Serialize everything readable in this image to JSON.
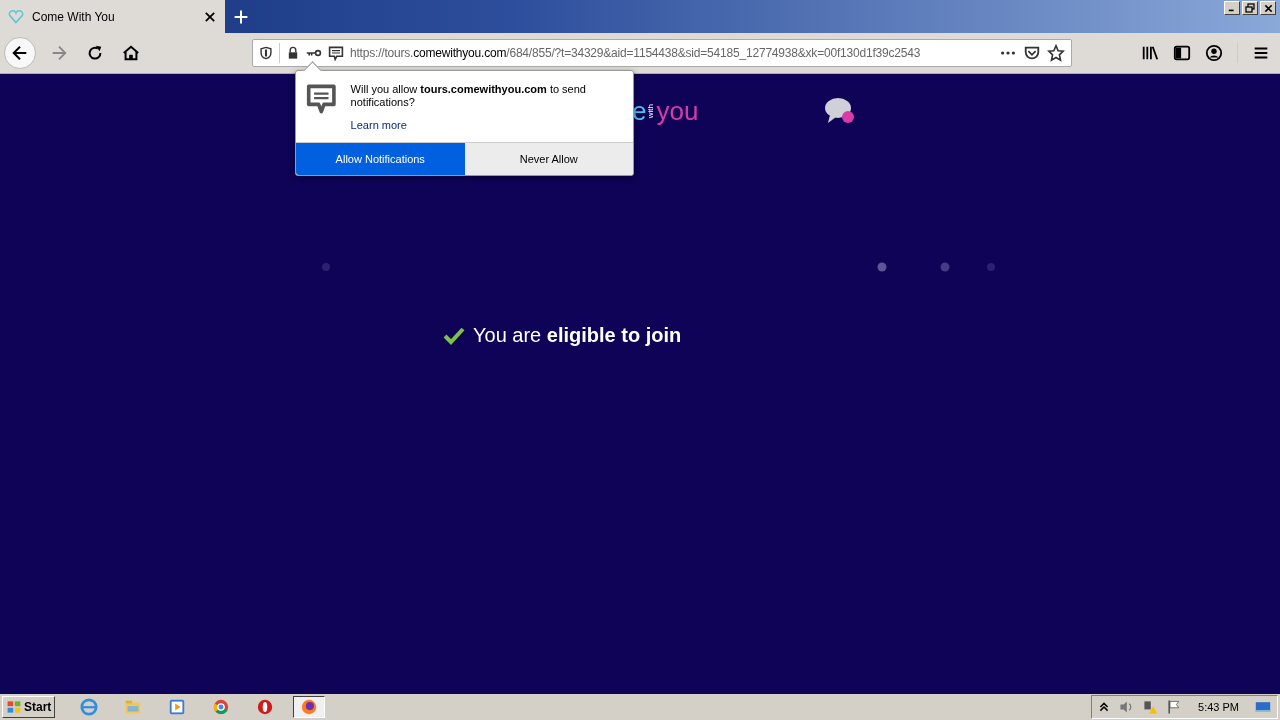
{
  "browser": {
    "tab": {
      "title": "Come With You",
      "selected": true
    },
    "url": {
      "prefix": "https://tours.",
      "domain": "comewithyou.com",
      "rest": "/684/855/?t=34329&aid=1154438&sid=54185_12774938&xk=00f130d1f39c2543"
    }
  },
  "page": {
    "logo": {
      "part_1": "e",
      "part_2": "with",
      "part_3": "you"
    },
    "status": "You are **eligible to join**"
  },
  "popup": {
    "message": "Will you allow **tours.comewithyou.com** to send notifications?",
    "link": "Learn more",
    "buttons": [
      {
        "label": "Allow Notifications",
        "kind": "primary"
      },
      {
        "label": "Never Allow",
        "kind": "secondary"
      }
    ]
  },
  "taskbar": {
    "start": "Start",
    "apps": [
      {
        "kind": "ie",
        "selected": false
      },
      {
        "kind": "folder",
        "selected": false
      },
      {
        "kind": "media",
        "selected": false
      },
      {
        "kind": "chrome",
        "selected": false
      },
      {
        "kind": "opera",
        "selected": false
      },
      {
        "kind": "firefox",
        "selected": true
      }
    ],
    "clock": "5:43 PM"
  }
}
